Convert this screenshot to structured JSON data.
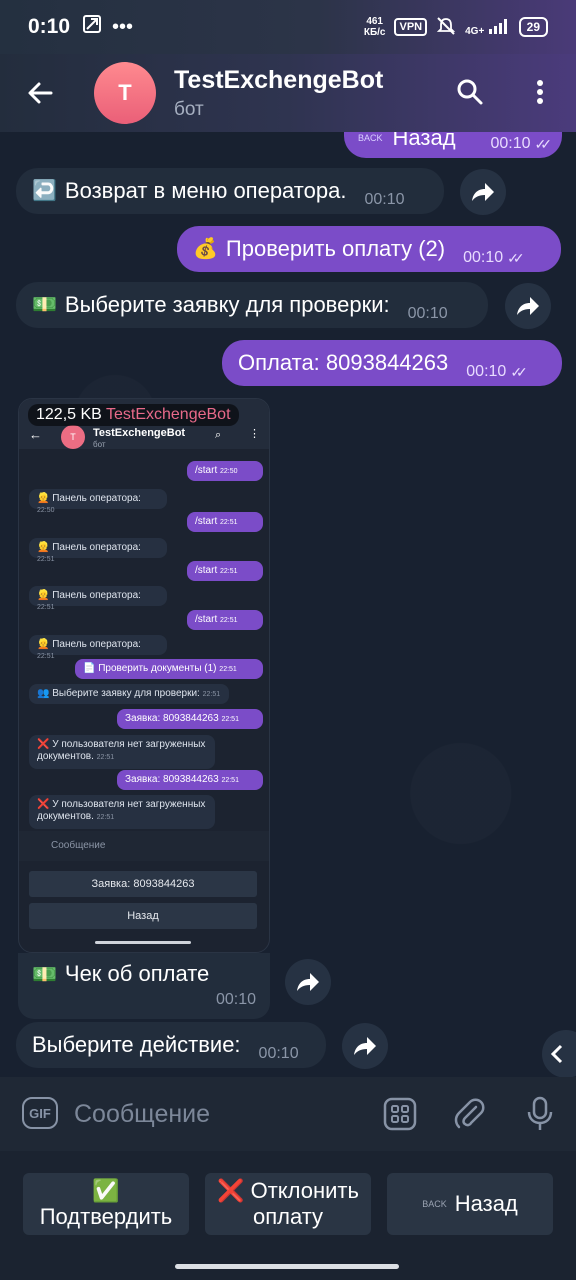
{
  "status_bar": {
    "time": "0:10",
    "net_speed": "461",
    "net_unit": "КБ/с",
    "vpn": "VPN",
    "network": "4G+",
    "battery": "29"
  },
  "header": {
    "avatar_letter": "T",
    "title": "TestExchengeBot",
    "subtitle": "бот"
  },
  "messages": {
    "m0": {
      "text": "Назад",
      "time": "00:10",
      "badge": "BACK"
    },
    "m1": {
      "icon": "↩️",
      "text": "Возврат в меню оператора.",
      "time": "00:10"
    },
    "m2": {
      "icon": "💰",
      "text": "Проверить оплату (2)",
      "time": "00:10"
    },
    "m3": {
      "icon": "💵",
      "text": "Выберите заявку для проверки:",
      "time": "00:10"
    },
    "m4": {
      "text": "Оплата: 8093844263",
      "time": "00:10"
    },
    "photo": {
      "size": "122,5 KB",
      "source": "TestExchengeBot",
      "caption_icon": "💵",
      "caption": "Чек об оплате",
      "time": "00:10"
    },
    "m6": {
      "text": "Выберите действие:",
      "time": "00:10"
    }
  },
  "mini_screen": {
    "title": "TestExchengeBot",
    "subtitle": "бот",
    "items": [
      {
        "text": "/start",
        "time": "22:50"
      },
      {
        "text": "👱 Панель оператора:",
        "time": "22:50"
      },
      {
        "text": "/start",
        "time": "22:51"
      },
      {
        "text": "👱 Панель оператора:",
        "time": "22:51"
      },
      {
        "text": "/start",
        "time": "22:51"
      },
      {
        "text": "👱 Панель оператора:",
        "time": "22:51"
      },
      {
        "text": "/start",
        "time": "22:51"
      },
      {
        "text": "👱 Панель оператора:",
        "time": "22:51"
      },
      {
        "text": "📄 Проверить документы (1)",
        "time": "22:51"
      },
      {
        "text": "👥 Выберите заявку для проверки:",
        "time": "22:51"
      },
      {
        "text": "Заявка: 8093844263",
        "time": "22:51"
      },
      {
        "text": "❌ У пользователя нет загруженных документов.",
        "time": "22:51"
      },
      {
        "text": "Заявка: 8093844263",
        "time": "22:51"
      },
      {
        "text": "❌ У пользователя нет загруженных документов.",
        "time": "22:51"
      }
    ],
    "input_placeholder": "Сообщение",
    "buttons": [
      "Заявка: 8093844263",
      "Назад"
    ]
  },
  "input": {
    "placeholder": "Сообщение",
    "gif": "GIF"
  },
  "keyboard": {
    "confirm_icon": "✅",
    "confirm": "Подтвердить",
    "reject_icon": "❌",
    "reject_line1": "Отклонить",
    "reject_line2": "оплату",
    "back_badge": "BACK",
    "back": "Назад"
  }
}
